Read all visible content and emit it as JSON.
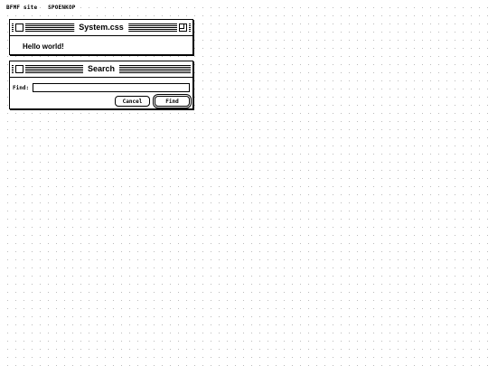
{
  "topbar": {
    "links": [
      "BFMF site",
      "SPOENKOP"
    ]
  },
  "window1": {
    "title": "System.css",
    "body_text": "Hello world!"
  },
  "search": {
    "title": "Search",
    "find_label": "Find:",
    "find_value": "",
    "cancel_label": "Cancel",
    "find_button_label": "Find"
  }
}
